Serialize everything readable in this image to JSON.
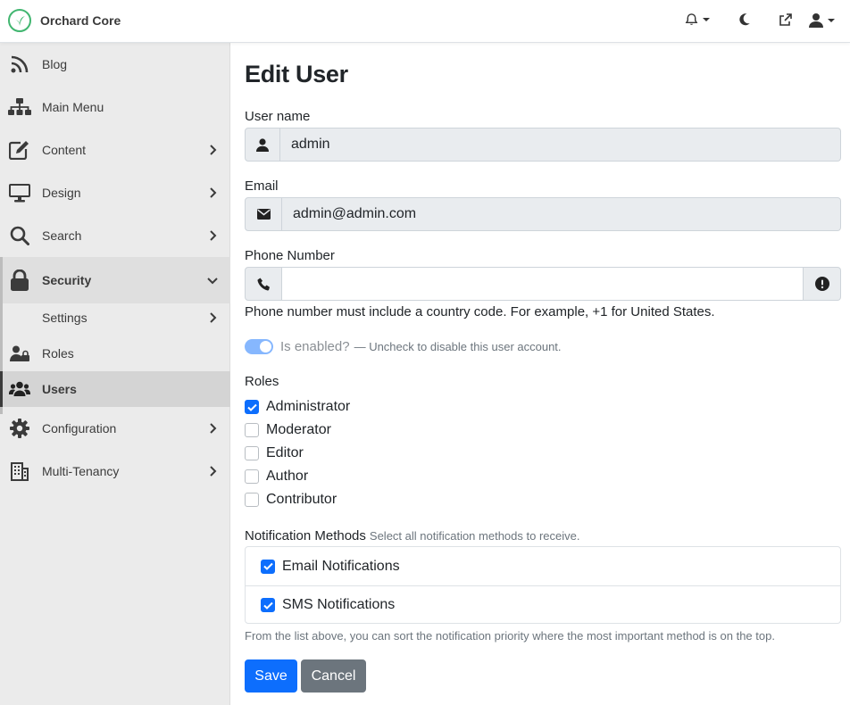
{
  "app": {
    "name": "Orchard Core",
    "brand_color": "#41b670"
  },
  "topbar": {
    "icons": [
      "bell-icon",
      "moon-icon",
      "external-link-icon",
      "user-icon"
    ]
  },
  "sidebar": {
    "items": [
      {
        "label": "Blog",
        "icon": "rss-icon"
      },
      {
        "label": "Main Menu",
        "icon": "sitemap-icon"
      },
      {
        "label": "Content",
        "icon": "edit-icon"
      },
      {
        "label": "Design",
        "icon": "monitor-icon"
      },
      {
        "label": "Search",
        "icon": "search-icon"
      },
      {
        "label": "Security",
        "icon": "lock-icon"
      },
      {
        "label": "Settings",
        "icon": ""
      },
      {
        "label": "Roles",
        "icon": "user-lock-icon"
      },
      {
        "label": "Users",
        "icon": "users-icon"
      },
      {
        "label": "Configuration",
        "icon": "gear-icon"
      },
      {
        "label": "Multi-Tenancy",
        "icon": "building-icon"
      }
    ]
  },
  "form": {
    "title": "Edit User",
    "username": {
      "label": "User name",
      "value": "admin"
    },
    "email": {
      "label": "Email",
      "value": "admin@admin.com"
    },
    "phone": {
      "label": "Phone Number",
      "value": "",
      "help": "Phone number must include a country code. For example, +1 for United States."
    },
    "enabled": {
      "label": "Is enabled?",
      "hint": "— Uncheck to disable this user account.",
      "checked": true
    },
    "roles": {
      "title": "Roles",
      "items": [
        {
          "label": "Administrator",
          "checked": true
        },
        {
          "label": "Moderator",
          "checked": false
        },
        {
          "label": "Editor",
          "checked": false
        },
        {
          "label": "Author",
          "checked": false
        },
        {
          "label": "Contributor",
          "checked": false
        }
      ]
    },
    "notifications": {
      "title": "Notification Methods",
      "hint": "Select all notification methods to receive.",
      "items": [
        {
          "label": "Email Notifications",
          "checked": true
        },
        {
          "label": "SMS Notifications",
          "checked": true
        }
      ],
      "footer": "From the list above, you can sort the notification priority where the most important method is on the top."
    },
    "buttons": {
      "save": "Save",
      "cancel": "Cancel"
    }
  },
  "colors": {
    "primary": "#0d6efd",
    "secondary": "#6c757d"
  }
}
